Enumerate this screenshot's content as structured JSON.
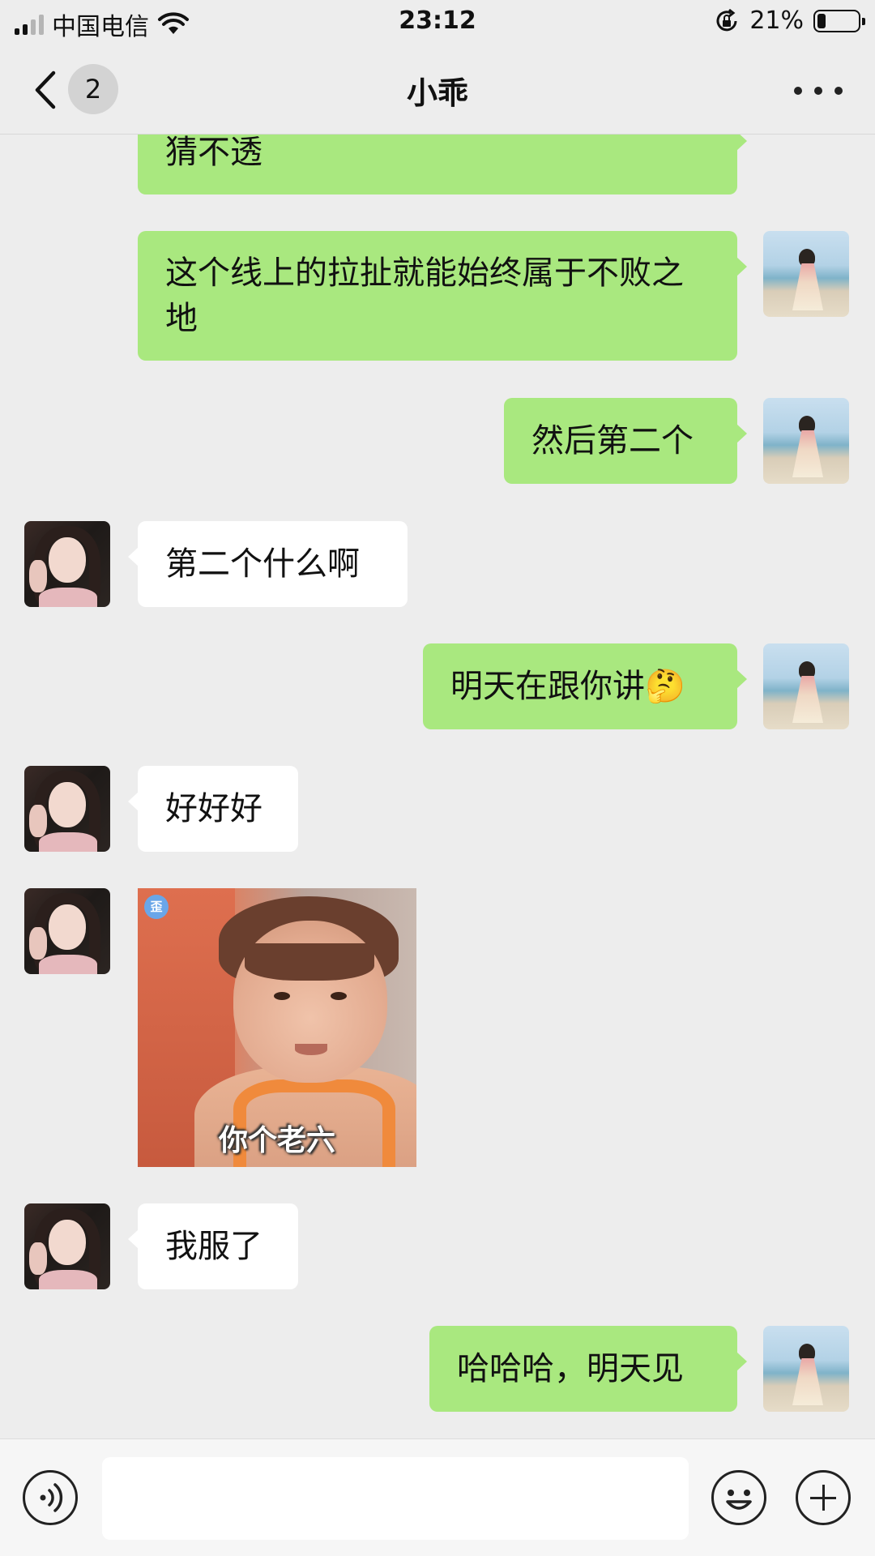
{
  "status_bar": {
    "carrier": "中国电信",
    "time": "23:12",
    "battery_percent": "21%",
    "battery_level": 0.21
  },
  "nav": {
    "unread_count": "2",
    "title": "小乖"
  },
  "messages": [
    {
      "from": "me",
      "text": "猜不透"
    },
    {
      "from": "me",
      "text": "这个线上的拉扯就能始终属于不败之地"
    },
    {
      "from": "me",
      "text": "然后第二个"
    },
    {
      "from": "them",
      "text": "第二个什么啊"
    },
    {
      "from": "me",
      "text": "明天在跟你讲",
      "emoji": "🤔"
    },
    {
      "from": "them",
      "text": "好好好"
    },
    {
      "from": "them",
      "type": "sticker",
      "caption": "你个老六"
    },
    {
      "from": "them",
      "text": "我服了"
    },
    {
      "from": "me",
      "text": "哈哈哈，明天见"
    }
  ],
  "icons": {
    "back": "chevron-left-icon",
    "more": "more-dots-icon",
    "voice": "voice-icon",
    "emoji": "emoji-icon",
    "plus": "plus-icon"
  },
  "colors": {
    "my_bubble": "#a9e87f",
    "their_bubble": "#ffffff",
    "background": "#ededed"
  }
}
